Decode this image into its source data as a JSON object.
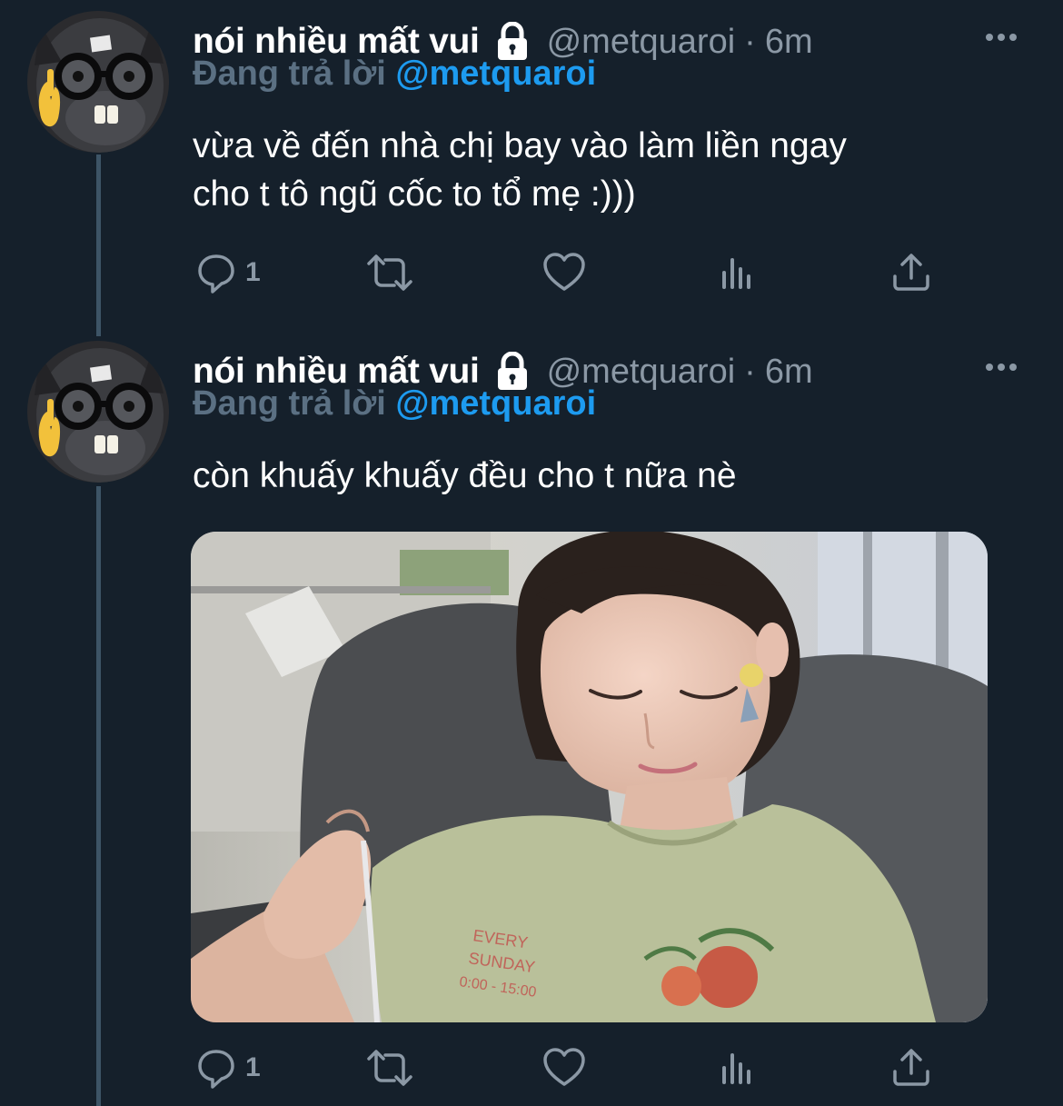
{
  "tweets": [
    {
      "display_name": "nói nhiều mất vui",
      "handle": "@metquaroi",
      "separator": "·",
      "time": "6m",
      "reply_prefix": "Đang trả lời",
      "reply_to": "@metquaroi",
      "text_lines": [
        "vừa về đến nhà chị bay vào làm liền ngay",
        "cho t tô ngũ cốc to tổ mẹ :)))"
      ],
      "reply_count": "1",
      "has_media": false
    },
    {
      "display_name": "nói nhiều mất vui",
      "handle": "@metquaroi",
      "separator": "·",
      "time": "6m",
      "reply_prefix": "Đang trả lời",
      "reply_to": "@metquaroi",
      "text_lines": [
        "còn khuấy khuấy đều cho t nữa nè"
      ],
      "reply_count": "1",
      "has_media": true,
      "media_text": [
        "EVERY",
        "SUNDAY",
        "0:00 - 15:00"
      ]
    }
  ],
  "icons": {
    "lock": "lock-icon",
    "more": "more-icon",
    "reply": "reply-icon",
    "retweet": "retweet-icon",
    "like": "like-icon",
    "analytics": "analytics-icon",
    "share": "share-icon"
  },
  "colors": {
    "background": "#15202b",
    "secondary_text": "#8b98a5",
    "reply_label": "#5b7083",
    "mention": "#1d9bf0",
    "thread_line": "#3d5466"
  }
}
